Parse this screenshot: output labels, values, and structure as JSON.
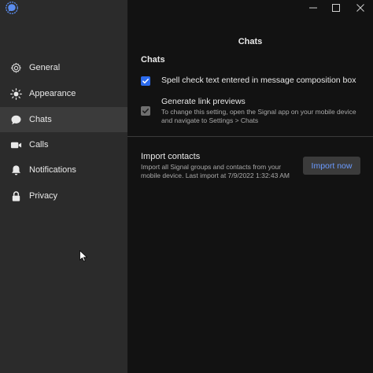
{
  "colors": {
    "accent": "#2c6bed",
    "sidebar_bg": "#2b2b2b",
    "sidebar_active_bg": "#3b3b3b",
    "main_bg": "#121212",
    "button_text": "#6b9bff"
  },
  "window": {
    "controls": [
      "minimize-icon",
      "maximize-icon",
      "close-icon"
    ]
  },
  "sidebar": {
    "items": [
      {
        "label": "General",
        "icon": "gear-icon"
      },
      {
        "label": "Appearance",
        "icon": "sun-icon"
      },
      {
        "label": "Chats",
        "icon": "chat-bubble-icon",
        "active": true
      },
      {
        "label": "Calls",
        "icon": "video-camera-icon"
      },
      {
        "label": "Notifications",
        "icon": "bell-icon"
      },
      {
        "label": "Privacy",
        "icon": "lock-icon"
      }
    ]
  },
  "main": {
    "title": "Chats",
    "section_title": "Chats",
    "spellcheck": {
      "label": "Spell check text entered in message composition box",
      "checked": true
    },
    "link_previews": {
      "label": "Generate link previews",
      "description": "To change this setting, open the Signal app on your mobile device and navigate to Settings > Chats",
      "checked": true,
      "disabled": true
    },
    "import": {
      "title": "Import contacts",
      "description": "Import all Signal groups and contacts from your mobile device. Last import at 7/9/2022 1:32:43 AM",
      "button_label": "Import now"
    }
  }
}
